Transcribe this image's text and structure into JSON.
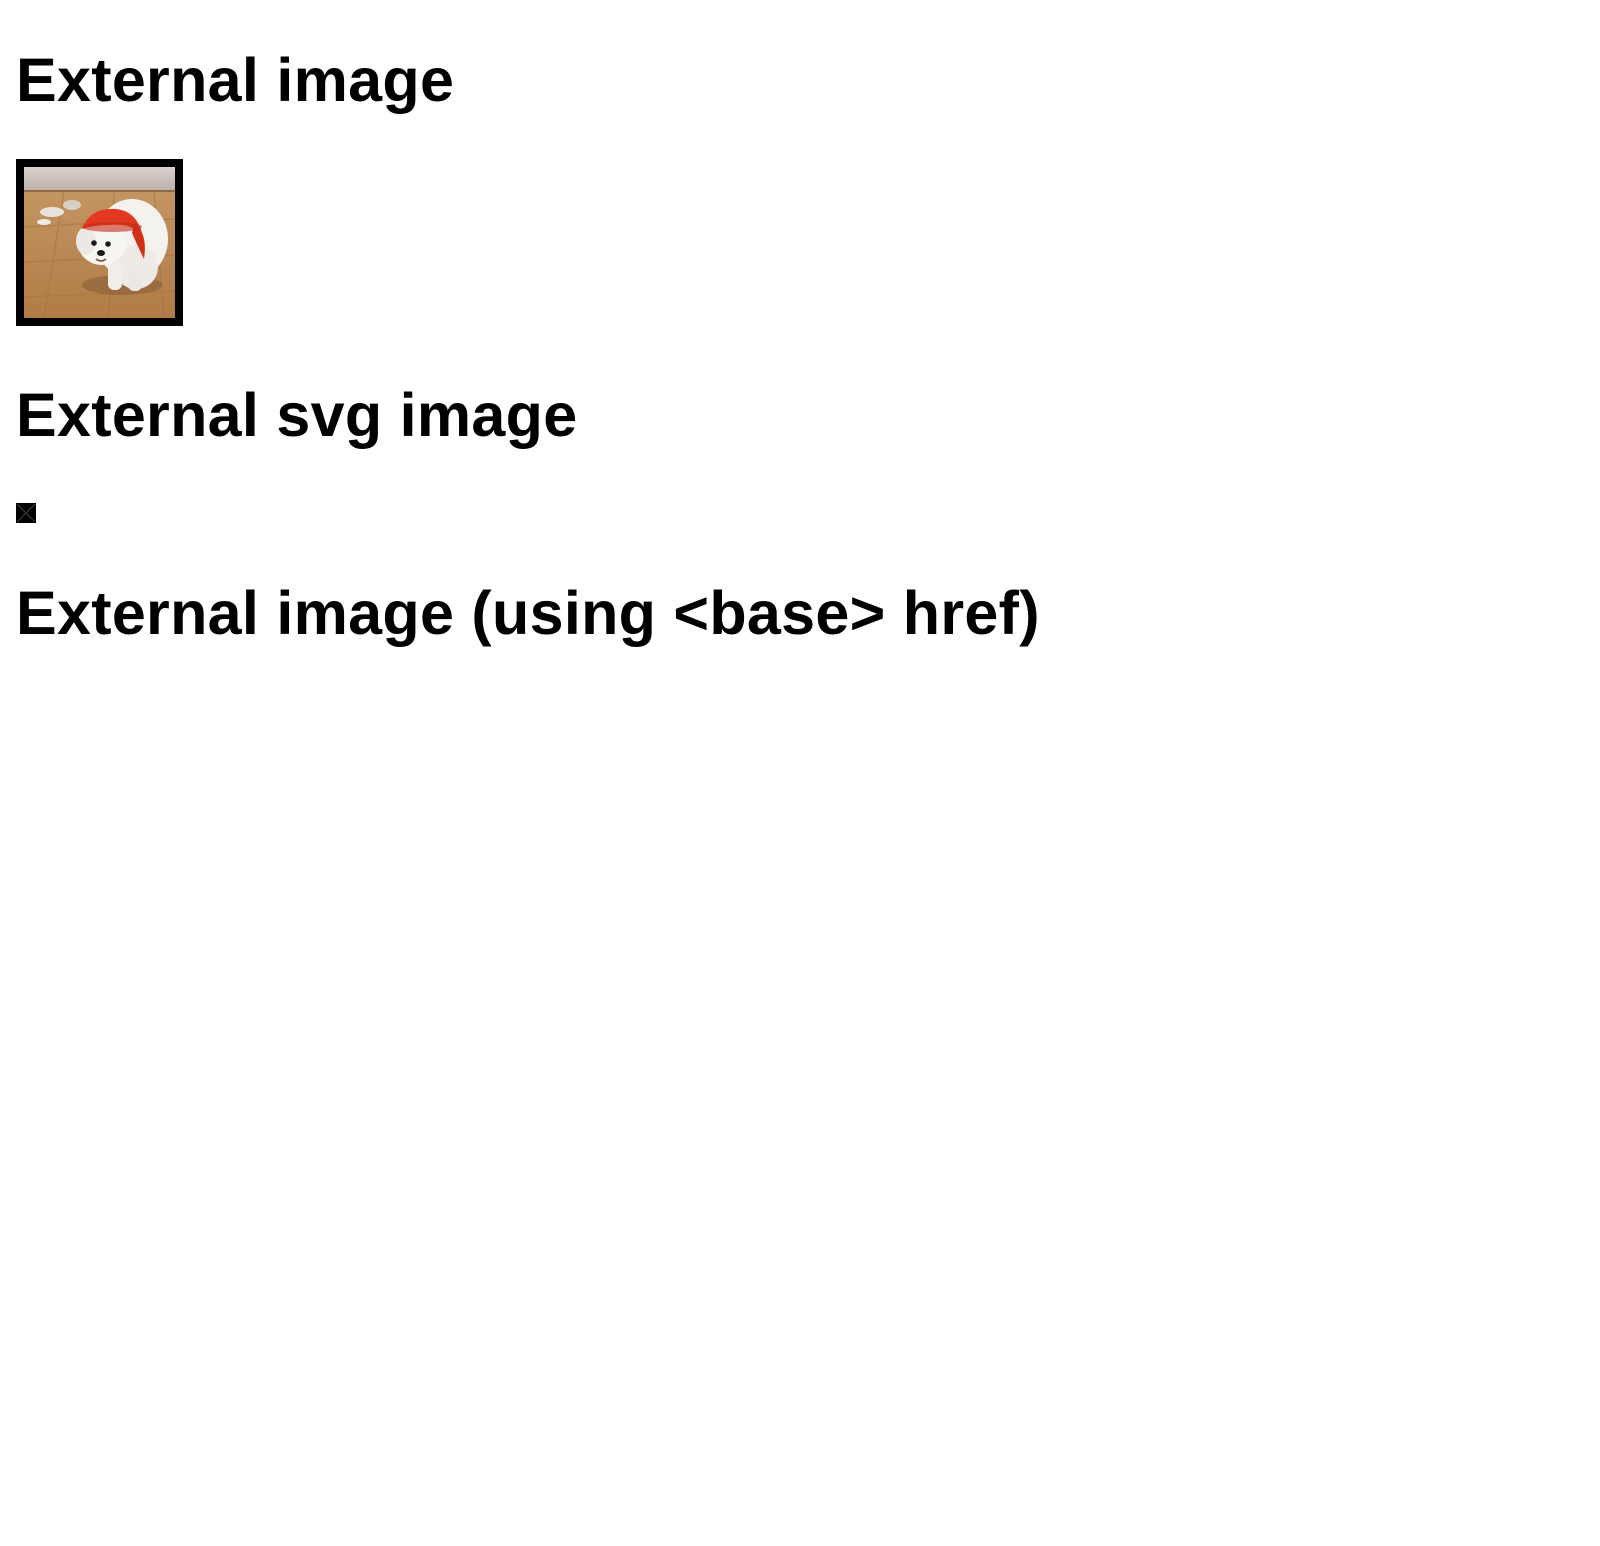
{
  "sections": [
    {
      "heading": "External image"
    },
    {
      "heading": "External svg image"
    },
    {
      "heading": "External image (using <base> href)"
    }
  ],
  "images": {
    "photo": {
      "icon": "dog-photo"
    },
    "svg_placeholder": {
      "icon": "broken-image-icon"
    }
  }
}
